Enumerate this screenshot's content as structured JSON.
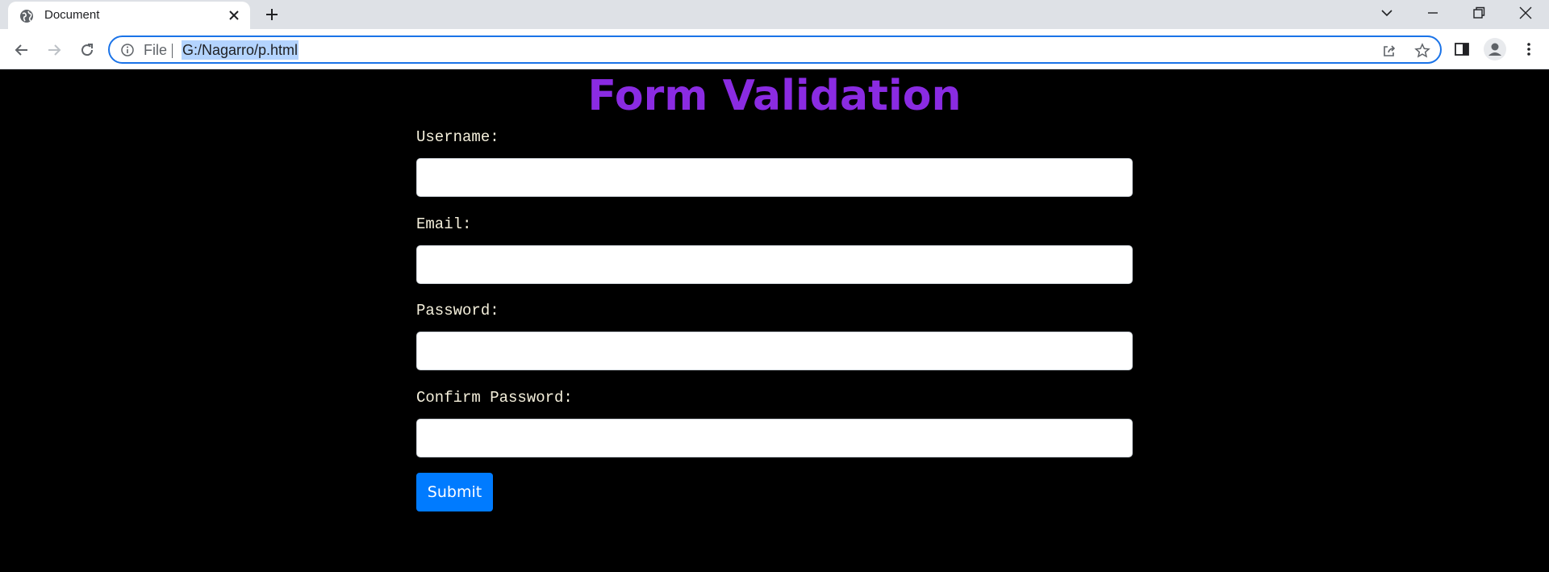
{
  "browser": {
    "tab": {
      "title": "Document"
    },
    "address_bar": {
      "scheme_label": "File",
      "url": "G:/Nagarro/p.html"
    }
  },
  "page": {
    "title": "Form Validation",
    "fields": [
      {
        "label": "Username:",
        "value": ""
      },
      {
        "label": "Email:",
        "value": ""
      },
      {
        "label": "Password:",
        "value": ""
      },
      {
        "label": "Confirm Password:",
        "value": ""
      }
    ],
    "submit_label": "Submit"
  },
  "colors": {
    "page_background": "#000000",
    "title": "#8a2be2",
    "label": "#f5f0dc",
    "submit_button": "#007bff",
    "address_focus": "#1a73e8",
    "url_selection": "#b4d4fe"
  }
}
